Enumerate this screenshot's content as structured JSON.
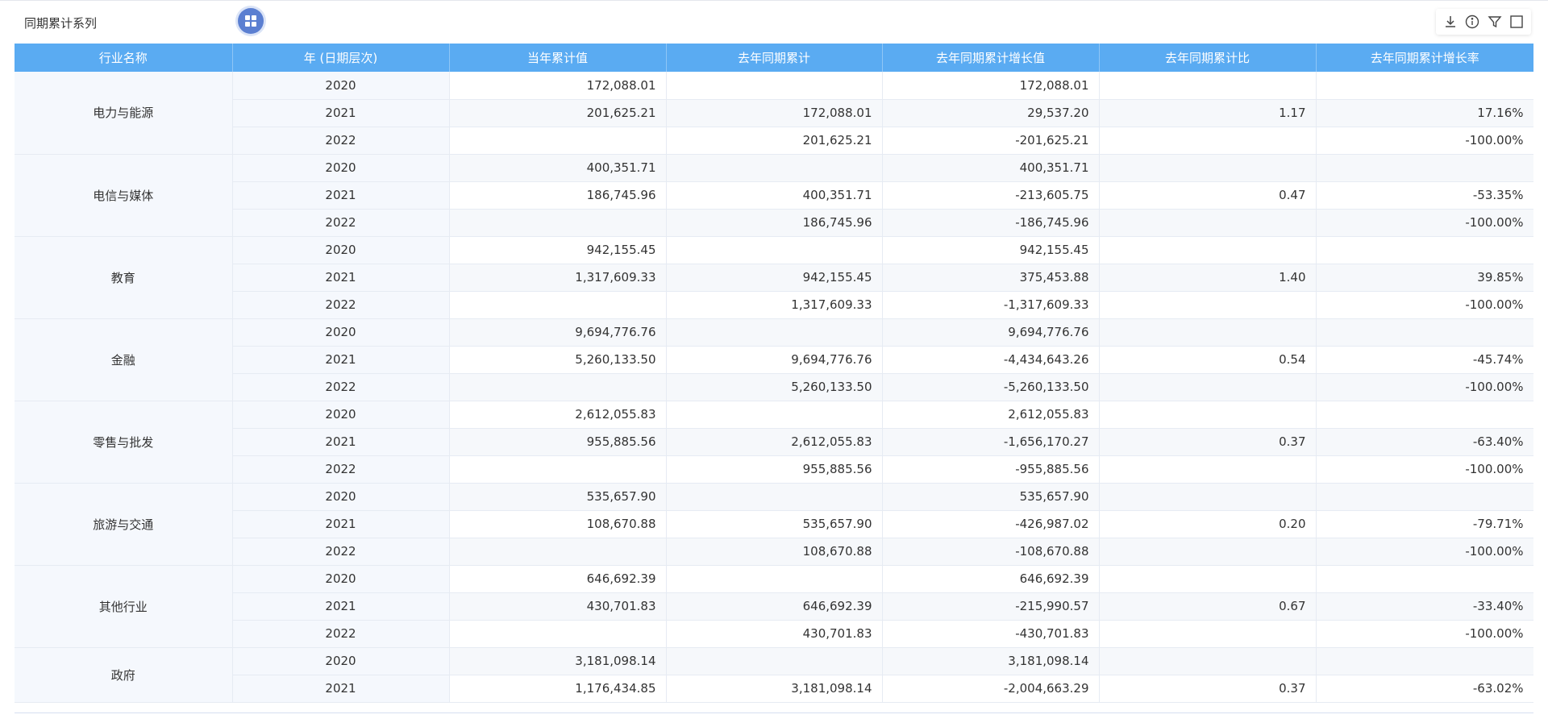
{
  "title": "同期累计系列",
  "toolbar": {
    "icons": [
      "download-icon",
      "info-icon",
      "filter-icon",
      "fullscreen-icon"
    ]
  },
  "colors": {
    "header_bg": "#5aabf2",
    "accent": "#5b7fd1"
  },
  "table": {
    "headers": [
      "行业名称",
      "年 (日期层次)",
      "当年累计值",
      "去年同期累计",
      "去年同期累计增长值",
      "去年同期累计比",
      "去年同期累计增长率"
    ],
    "groups": [
      {
        "industry": "电力与能源",
        "rows": [
          [
            "2020",
            "172,088.01",
            "",
            "172,088.01",
            "",
            ""
          ],
          [
            "2021",
            "201,625.21",
            "172,088.01",
            "29,537.20",
            "1.17",
            "17.16%"
          ],
          [
            "2022",
            "",
            "201,625.21",
            "-201,625.21",
            "",
            "-100.00%"
          ]
        ]
      },
      {
        "industry": "电信与媒体",
        "rows": [
          [
            "2020",
            "400,351.71",
            "",
            "400,351.71",
            "",
            ""
          ],
          [
            "2021",
            "186,745.96",
            "400,351.71",
            "-213,605.75",
            "0.47",
            "-53.35%"
          ],
          [
            "2022",
            "",
            "186,745.96",
            "-186,745.96",
            "",
            "-100.00%"
          ]
        ]
      },
      {
        "industry": "教育",
        "rows": [
          [
            "2020",
            "942,155.45",
            "",
            "942,155.45",
            "",
            ""
          ],
          [
            "2021",
            "1,317,609.33",
            "942,155.45",
            "375,453.88",
            "1.40",
            "39.85%"
          ],
          [
            "2022",
            "",
            "1,317,609.33",
            "-1,317,609.33",
            "",
            "-100.00%"
          ]
        ]
      },
      {
        "industry": "金融",
        "rows": [
          [
            "2020",
            "9,694,776.76",
            "",
            "9,694,776.76",
            "",
            ""
          ],
          [
            "2021",
            "5,260,133.50",
            "9,694,776.76",
            "-4,434,643.26",
            "0.54",
            "-45.74%"
          ],
          [
            "2022",
            "",
            "5,260,133.50",
            "-5,260,133.50",
            "",
            "-100.00%"
          ]
        ]
      },
      {
        "industry": "零售与批发",
        "rows": [
          [
            "2020",
            "2,612,055.83",
            "",
            "2,612,055.83",
            "",
            ""
          ],
          [
            "2021",
            "955,885.56",
            "2,612,055.83",
            "-1,656,170.27",
            "0.37",
            "-63.40%"
          ],
          [
            "2022",
            "",
            "955,885.56",
            "-955,885.56",
            "",
            "-100.00%"
          ]
        ]
      },
      {
        "industry": "旅游与交通",
        "rows": [
          [
            "2020",
            "535,657.90",
            "",
            "535,657.90",
            "",
            ""
          ],
          [
            "2021",
            "108,670.88",
            "535,657.90",
            "-426,987.02",
            "0.20",
            "-79.71%"
          ],
          [
            "2022",
            "",
            "108,670.88",
            "-108,670.88",
            "",
            "-100.00%"
          ]
        ]
      },
      {
        "industry": "其他行业",
        "rows": [
          [
            "2020",
            "646,692.39",
            "",
            "646,692.39",
            "",
            ""
          ],
          [
            "2021",
            "430,701.83",
            "646,692.39",
            "-215,990.57",
            "0.67",
            "-33.40%"
          ],
          [
            "2022",
            "",
            "430,701.83",
            "-430,701.83",
            "",
            "-100.00%"
          ]
        ]
      },
      {
        "industry": "政府",
        "rows": [
          [
            "2020",
            "3,181,098.14",
            "",
            "3,181,098.14",
            "",
            ""
          ],
          [
            "2021",
            "1,176,434.85",
            "3,181,098.14",
            "-2,004,663.29",
            "0.37",
            "-63.02%"
          ]
        ]
      }
    ]
  }
}
